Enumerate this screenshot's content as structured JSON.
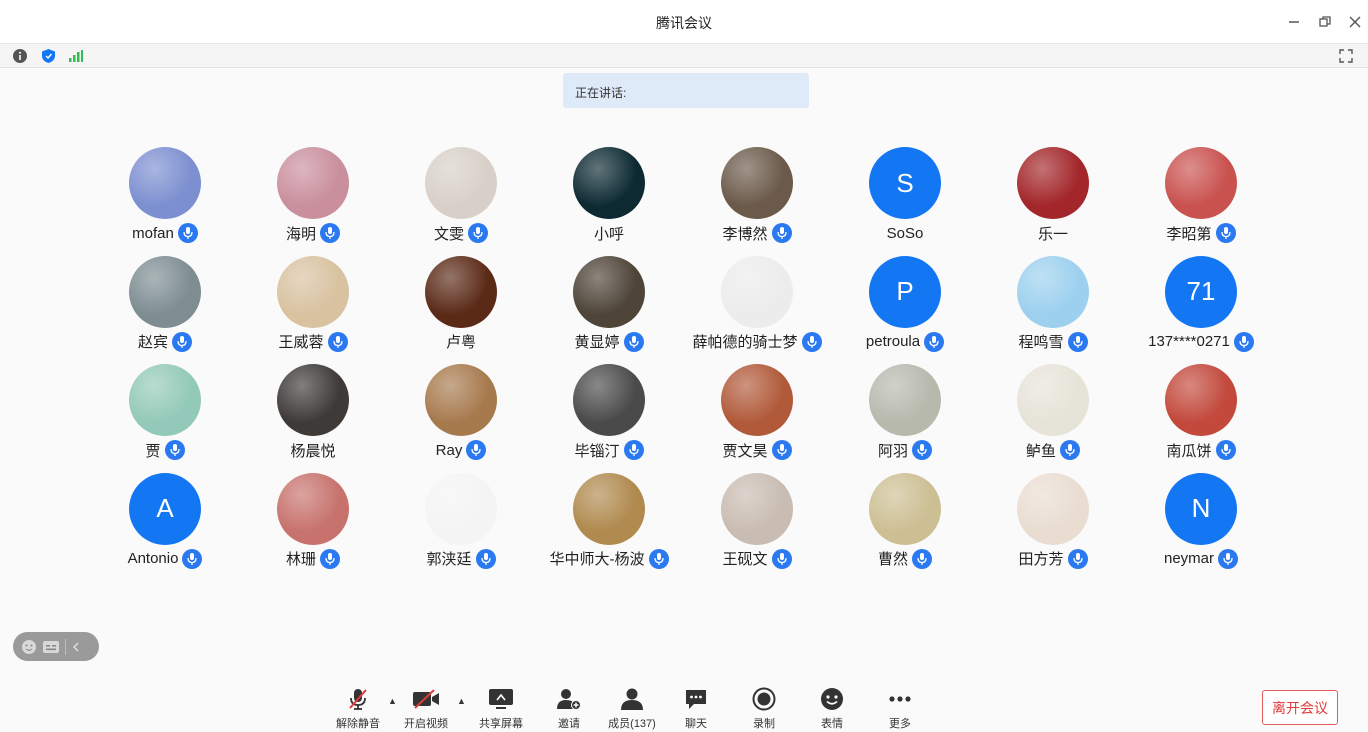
{
  "window": {
    "title": "腾讯会议"
  },
  "speaking": {
    "label": "正在讲话:"
  },
  "participants": [
    {
      "name": "mofan",
      "avatar": "photo",
      "bg": "#7c8fd0",
      "mic": true
    },
    {
      "name": "海明",
      "avatar": "photo",
      "bg": "#c98f9d",
      "mic": true
    },
    {
      "name": "文雯",
      "avatar": "photo",
      "bg": "#d8d0c8",
      "mic": true
    },
    {
      "name": "小呼",
      "avatar": "photo",
      "bg": "#0d2a33",
      "mic": false
    },
    {
      "name": "李博然",
      "avatar": "photo",
      "bg": "#6b5a4a",
      "mic": true
    },
    {
      "name": "SoSo",
      "avatar": "letter",
      "initial": "S",
      "mic": false
    },
    {
      "name": "乐一",
      "avatar": "photo",
      "bg": "#a3262a",
      "mic": false
    },
    {
      "name": "李昭第",
      "avatar": "photo",
      "bg": "#c9524f",
      "mic": true
    },
    {
      "name": "赵宾",
      "avatar": "photo",
      "bg": "#7d8d92",
      "mic": true
    },
    {
      "name": "王威蓉",
      "avatar": "photo",
      "bg": "#d8c2a0",
      "mic": true
    },
    {
      "name": "卢粤",
      "avatar": "photo",
      "bg": "#5b2a17",
      "mic": false
    },
    {
      "name": "黄显婷",
      "avatar": "photo",
      "bg": "#4e4438",
      "mic": true
    },
    {
      "name": "薛帕德的骑士梦",
      "avatar": "photo",
      "bg": "#ececec",
      "mic": true
    },
    {
      "name": "petroula",
      "avatar": "letter",
      "initial": "P",
      "mic": true
    },
    {
      "name": "程鸣雪",
      "avatar": "photo",
      "bg": "#9cd0ee",
      "mic": true
    },
    {
      "name": "137****0271",
      "avatar": "letter",
      "initial": "71",
      "mic": true
    },
    {
      "name": "贾",
      "avatar": "photo",
      "bg": "#93c9b8",
      "mic": true
    },
    {
      "name": "杨晨悦",
      "avatar": "photo",
      "bg": "#3d3a38",
      "mic": false
    },
    {
      "name": "Ray",
      "avatar": "photo",
      "bg": "#a77a4e",
      "mic": true
    },
    {
      "name": "毕锱汀",
      "avatar": "photo",
      "bg": "#4a4a4a",
      "mic": true
    },
    {
      "name": "贾文昊",
      "avatar": "photo",
      "bg": "#b15a3a",
      "mic": true
    },
    {
      "name": "阿羽",
      "avatar": "photo",
      "bg": "#b7b9ad",
      "mic": true
    },
    {
      "name": "鲈鱼",
      "avatar": "photo",
      "bg": "#e6e3d8",
      "mic": true
    },
    {
      "name": "南瓜饼",
      "avatar": "photo",
      "bg": "#c2493c",
      "mic": true
    },
    {
      "name": "Antonio",
      "avatar": "letter",
      "initial": "A",
      "mic": true
    },
    {
      "name": "林珊",
      "avatar": "photo",
      "bg": "#c7726c",
      "mic": true
    },
    {
      "name": "郭浃廷",
      "avatar": "photo",
      "bg": "#f4f4f4",
      "mic": true
    },
    {
      "name": "华中师大-杨波",
      "avatar": "photo",
      "bg": "#b08a4e",
      "mic": true
    },
    {
      "name": "王砚文",
      "avatar": "photo",
      "bg": "#c9bcb2",
      "mic": true
    },
    {
      "name": "曹然",
      "avatar": "photo",
      "bg": "#cdbf94",
      "mic": true
    },
    {
      "name": "田方芳",
      "avatar": "photo",
      "bg": "#e9ddd2",
      "mic": true
    },
    {
      "name": "neymar",
      "avatar": "letter",
      "initial": "N",
      "mic": true
    }
  ],
  "toolbar": {
    "unmute": "解除静音",
    "start_video": "开启视频",
    "share_screen": "共享屏幕",
    "invite": "邀请",
    "members": "成员(137)",
    "chat": "聊天",
    "record": "录制",
    "emoji": "表情",
    "more": "更多"
  },
  "leave": {
    "label": "离开会议"
  },
  "colors": {
    "accent": "#1377f4",
    "mic": "#2b79f0",
    "leave": "#e03a3a",
    "signal": "#2fbf4f"
  }
}
